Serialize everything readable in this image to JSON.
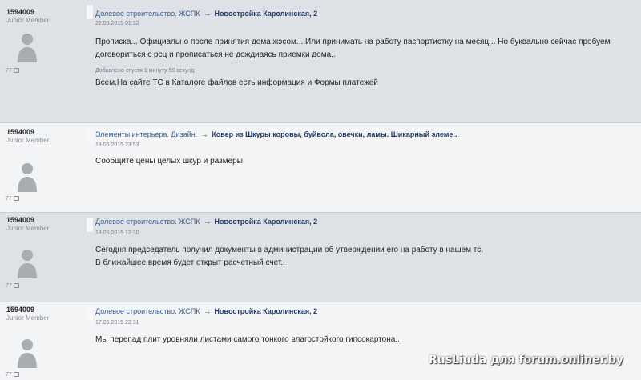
{
  "posts": [
    {
      "username": "1594009",
      "rank": "Junior Member",
      "post_count": "77",
      "section": "Долевое строительство. ЖСПК",
      "arrow": "→",
      "topic_title": "Новостройка Каролинская, 2",
      "date": "22.05.2015 01:32",
      "text_lines": [
        "Прописка... Официально после принятия дома жэсом... Или принимать на работу паспортистку на месяц... Но буквально сейчас пробуем",
        "договориться с рсц и прописаться не дождиаясь приемки дома.."
      ],
      "added_note": "Добавлено спустя 1 минуту 59 секунд",
      "added_text": "Всем.На сайте ТС в Каталоге файлов есть информация и Формы платежей"
    },
    {
      "username": "1594009",
      "rank": "Junior Member",
      "post_count": "77",
      "section": "Элементы интерьера. Дизайн.",
      "arrow": "→",
      "topic_title": "Ковер из Шкуры коровы, буйвола, овечки, ламы. Шикарный элеме...",
      "date": "18.05.2015 23:53",
      "text_lines": [
        "Сообщите цены целых шкур и размеры"
      ]
    },
    {
      "username": "1594009",
      "rank": "Junior Member",
      "post_count": "77",
      "section": "Долевое строительство. ЖСПК",
      "arrow": "→",
      "topic_title": "Новостройка Каролинская, 2",
      "date": "18.05.2015 12:30",
      "text_lines": [
        "Сегодня председатель получил документы в администрации об утверждении его на работу в нашем тс.",
        "В ближайшее время будет открыт расчетный счет.."
      ]
    },
    {
      "username": "1594009",
      "rank": "Junior Member",
      "post_count": "77",
      "section": "Долевое строительство. ЖСПК",
      "arrow": "→",
      "topic_title": "Новостройка Каролинская, 2",
      "date": "17.05.2015 22:31",
      "text_lines": [
        "Мы перепад плит уровняли листами самого тонкого влагостойкого гипсокартона.."
      ]
    }
  ],
  "watermark": "RusLiuda для forum.onliner.by",
  "colors": {
    "link": "#3b5f94",
    "topic_title": "#203a67",
    "row_bg": "#dee1e5",
    "row_bg_alt": "#e7e9ec"
  }
}
